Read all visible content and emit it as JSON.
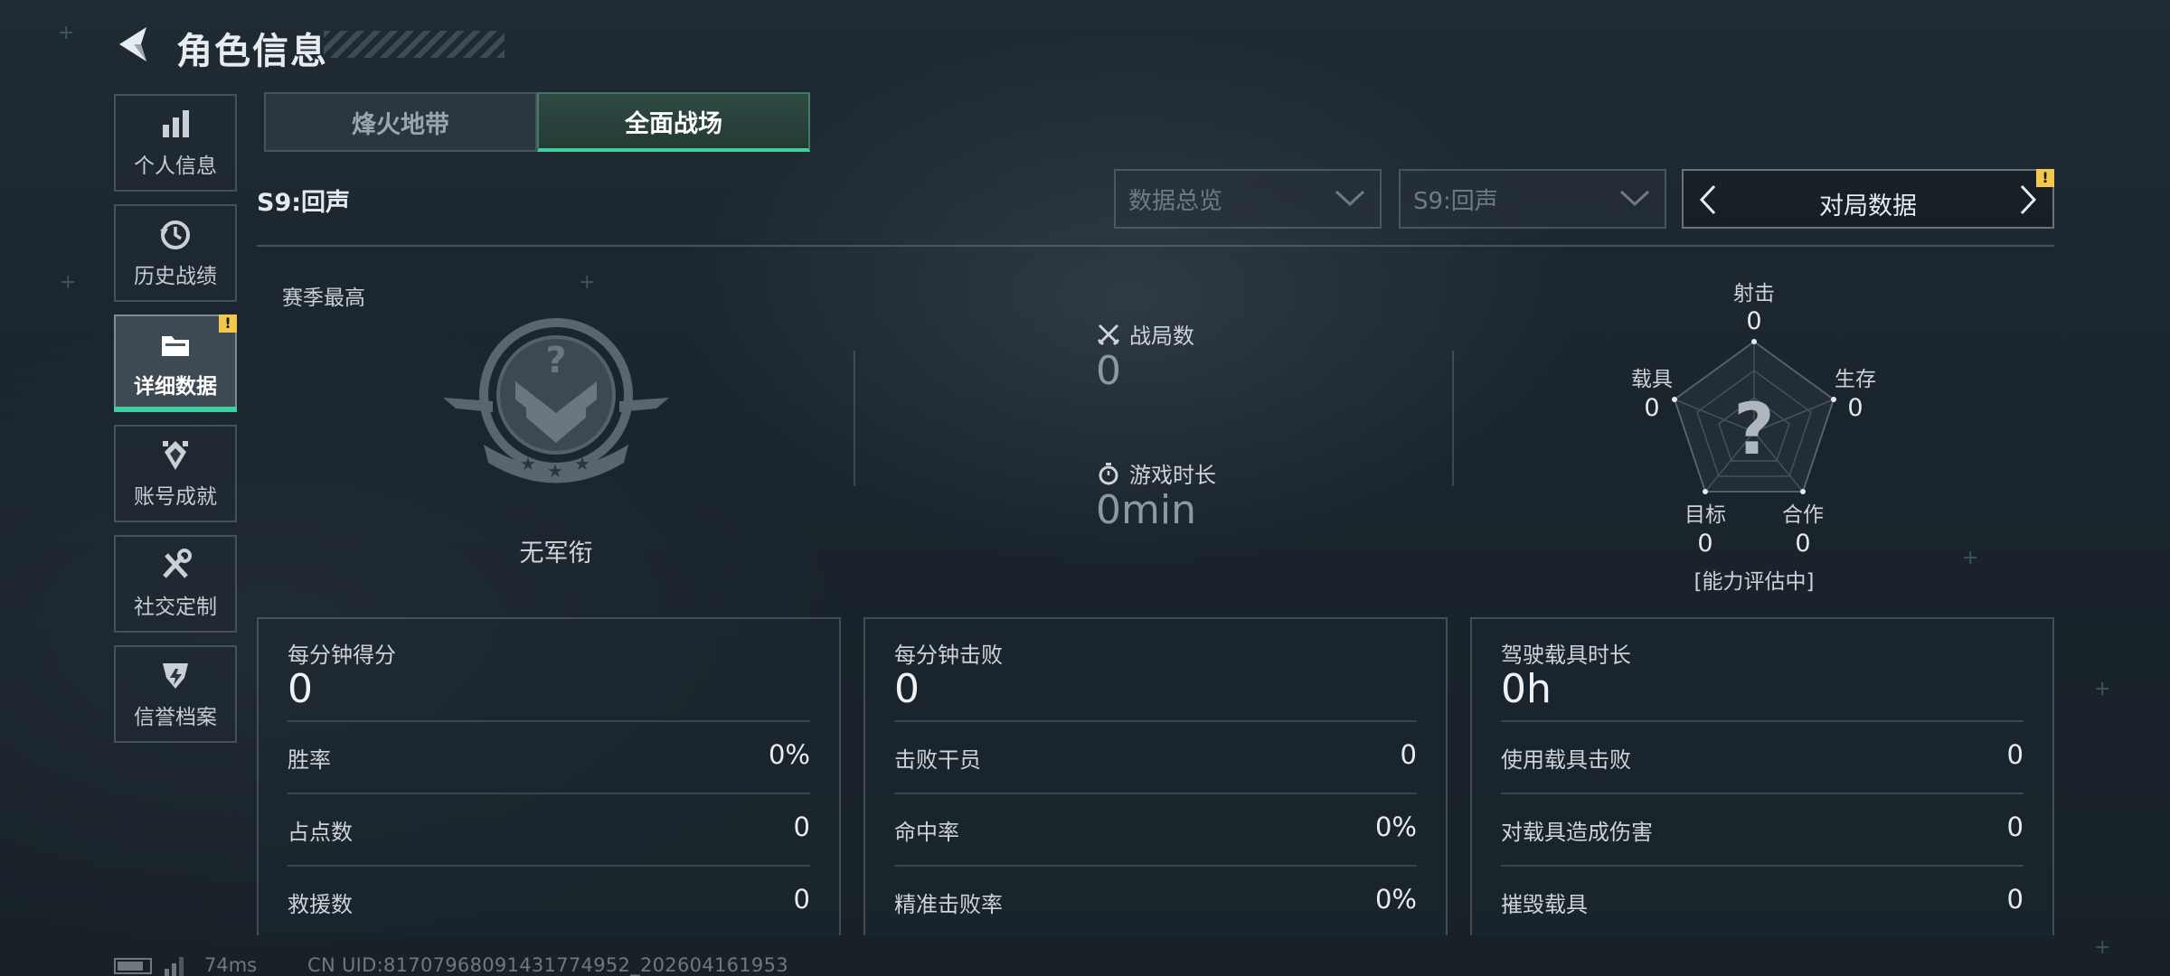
{
  "header": {
    "title": "角色信息"
  },
  "sidebar": {
    "items": [
      {
        "label": "个人信息",
        "icon": "bar-chart-icon",
        "active": false
      },
      {
        "label": "历史战绩",
        "icon": "history-clock-icon",
        "active": false
      },
      {
        "label": "详细数据",
        "icon": "folder-icon",
        "active": true,
        "badge": "!"
      },
      {
        "label": "账号成就",
        "icon": "achievement-icon",
        "active": false
      },
      {
        "label": "社交定制",
        "icon": "tools-icon",
        "active": false
      },
      {
        "label": "信誉档案",
        "icon": "credit-shield-icon",
        "active": false
      }
    ]
  },
  "mode_tabs": [
    {
      "label": "烽火地带",
      "selected": false
    },
    {
      "label": "全面战场",
      "selected": true
    }
  ],
  "season": {
    "label": "S9:回声"
  },
  "filters": {
    "data_type": "数据总览",
    "season": "S9:回声",
    "switcher": "对局数据",
    "switcher_badge": "!"
  },
  "rank": {
    "label": "赛季最高",
    "name": "无军衔"
  },
  "summary": {
    "matches": {
      "label": "战局数",
      "value": "0"
    },
    "playtime": {
      "label": "游戏时长",
      "value": "0min"
    }
  },
  "radar": {
    "axes": [
      {
        "label": "射击",
        "value": "0"
      },
      {
        "label": "生存",
        "value": "0"
      },
      {
        "label": "合作",
        "value": "0"
      },
      {
        "label": "目标",
        "value": "0"
      },
      {
        "label": "载具",
        "value": "0"
      }
    ],
    "center": "?",
    "status": "[能力评估中]"
  },
  "panels": [
    {
      "title": "每分钟得分",
      "value": "0",
      "rows": [
        {
          "label": "胜率",
          "value": "0%"
        },
        {
          "label": "占点数",
          "value": "0"
        },
        {
          "label": "救援数",
          "value": "0"
        }
      ]
    },
    {
      "title": "每分钟击败",
      "value": "0",
      "rows": [
        {
          "label": "击败干员",
          "value": "0"
        },
        {
          "label": "命中率",
          "value": "0%"
        },
        {
          "label": "精准击败率",
          "value": "0%"
        }
      ]
    },
    {
      "title": "驾驶载具时长",
      "value": "0h",
      "rows": [
        {
          "label": "使用载具击败",
          "value": "0"
        },
        {
          "label": "对载具造成伤害",
          "value": "0"
        },
        {
          "label": "摧毁载具",
          "value": "0"
        }
      ]
    }
  ],
  "footer": {
    "ping": "74ms",
    "uid": "CN UID:81707968091431774952_202604161953"
  },
  "colors": {
    "accent": "#3ecf9c",
    "warning": "#f2c94c",
    "background": "#1c262e"
  }
}
